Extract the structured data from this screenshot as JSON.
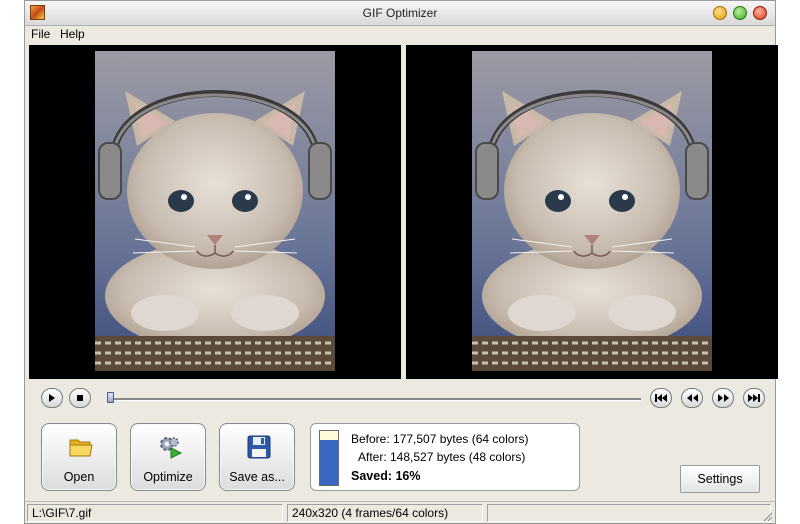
{
  "window": {
    "title": "GIF Optimizer"
  },
  "menu": {
    "file": "File",
    "help": "Help"
  },
  "previews": {
    "left": {
      "image": "kitten-with-headphones"
    },
    "right": {
      "image": "kitten-with-headphones"
    }
  },
  "playback": {
    "icons": [
      "play-icon",
      "stop-icon",
      "first-frame-icon",
      "previous-frame-icon",
      "next-frame-icon",
      "last-frame-icon"
    ]
  },
  "toolbar": {
    "open_label": "Open",
    "optimize_label": "Optimize",
    "save_as_label": "Save as...",
    "settings_label": "Settings"
  },
  "stats": {
    "before": "Before: 177,507 bytes (64 colors)",
    "after": "After: 148,527 bytes (48 colors)",
    "saved": "Saved: 16%",
    "after_ratio": 0.84
  },
  "status": {
    "path": "L:\\GIF\\7.gif",
    "info": "240x320 (4 frames/64 colors)",
    "extra": ""
  },
  "colors": {
    "preview_bg": "#000000",
    "bar_fill": "#3a68c0",
    "window_bg": "#ece9e0"
  }
}
